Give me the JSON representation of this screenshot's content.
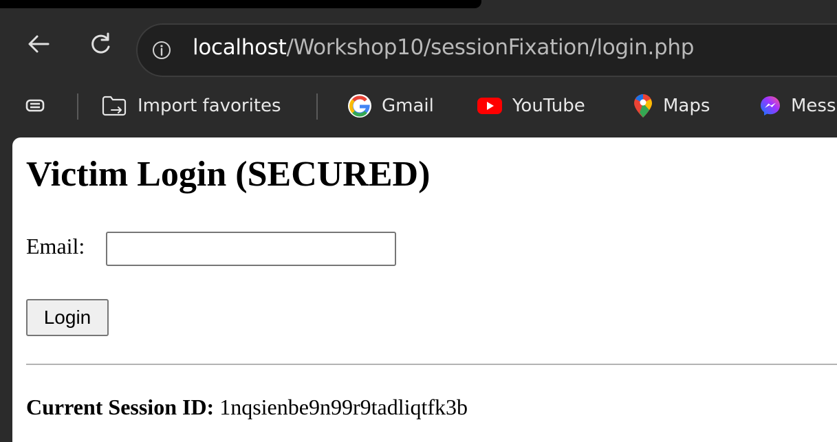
{
  "browser": {
    "address_bar": {
      "host": "localhost",
      "path": "/Workshop10/sessionFixation/login.php"
    },
    "favorites_bar": {
      "import_label": "Import favorites",
      "items": [
        {
          "label": "Gmail",
          "icon": "gmail-icon"
        },
        {
          "label": "YouTube",
          "icon": "youtube-icon"
        },
        {
          "label": "Maps",
          "icon": "maps-icon"
        },
        {
          "label": "Mess",
          "icon": "messenger-icon"
        }
      ]
    }
  },
  "page": {
    "title": "Victim Login (SECURED)",
    "form": {
      "email_label": "Email:",
      "email_value": "",
      "login_button": "Login"
    },
    "session": {
      "label": "Current Session ID:",
      "value": "1nqsienbe9n99r9tadliqtfk3b"
    }
  },
  "colors": {
    "browser_chrome": "#2b2b2b",
    "omnibox_bg": "#202020",
    "page_bg": "#ffffff",
    "youtube_red": "#ff0000",
    "messenger_purple": "#a033ff"
  }
}
